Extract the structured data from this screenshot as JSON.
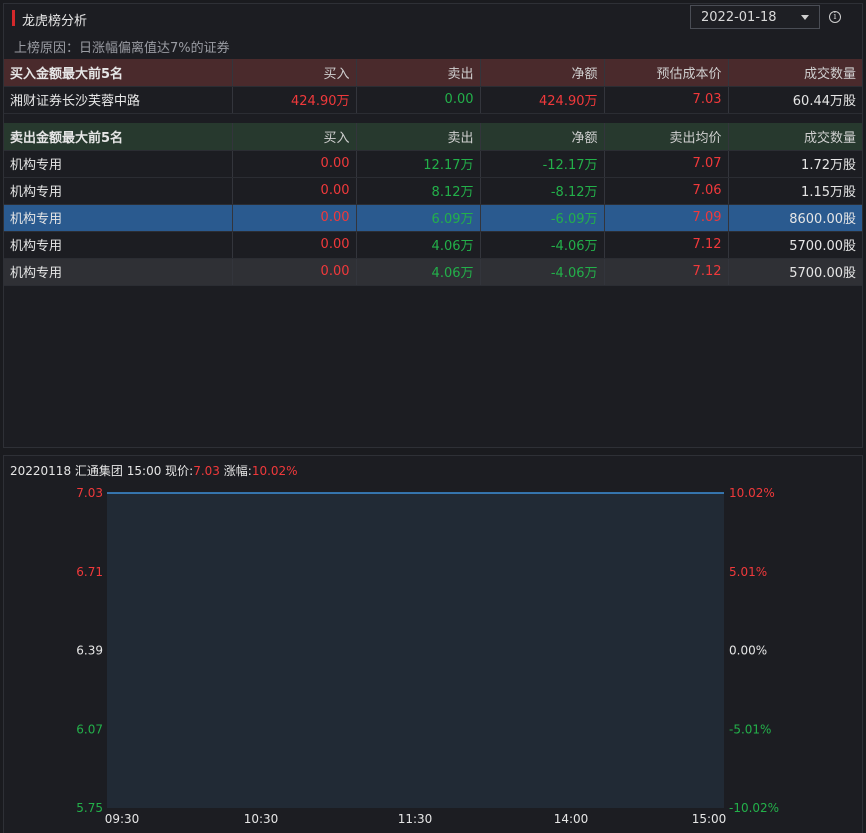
{
  "header": {
    "title": "龙虎榜分析",
    "date": "2022-01-18",
    "info_icon": "info-icon"
  },
  "reason": "上榜原因：日涨幅偏离值达7%的证券",
  "buy_table": {
    "headers": [
      "买入金额最大前5名",
      "买入",
      "卖出",
      "净额",
      "预估成本价",
      "成交数量"
    ],
    "rows": [
      [
        "湘财证券长沙芙蓉中路",
        "424.90万",
        "0.00",
        "424.90万",
        "7.03",
        "60.44万股"
      ]
    ]
  },
  "sell_table": {
    "headers": [
      "卖出金额最大前5名",
      "买入",
      "卖出",
      "净额",
      "卖出均价",
      "成交数量"
    ],
    "rows": [
      [
        "机构专用",
        "0.00",
        "12.17万",
        "-12.17万",
        "7.07",
        "1.72万股"
      ],
      [
        "机构专用",
        "0.00",
        "8.12万",
        "-8.12万",
        "7.06",
        "1.15万股"
      ],
      [
        "机构专用",
        "0.00",
        "6.09万",
        "-6.09万",
        "7.09",
        "8600.00股"
      ],
      [
        "机构专用",
        "0.00",
        "4.06万",
        "-4.06万",
        "7.12",
        "5700.00股"
      ],
      [
        "机构专用",
        "0.00",
        "4.06万",
        "-4.06万",
        "7.12",
        "5700.00股"
      ]
    ],
    "selected_row": 2,
    "hover_row": 4
  },
  "chart_info": {
    "date": "20220118",
    "stock": "汇通集团",
    "time": "15:00",
    "price_label": "现价:",
    "price": "7.03",
    "change_label": "涨幅:",
    "change": "10.02%"
  },
  "chart_data": {
    "type": "line",
    "x_ticks": [
      "09:30",
      "10:30",
      "11:30",
      "14:00",
      "15:00"
    ],
    "y_left_ticks": [
      "7.03",
      "6.71",
      "6.39",
      "6.07",
      "5.75"
    ],
    "y_right_ticks": [
      "10.02%",
      "5.01%",
      "0.00%",
      "-5.01%",
      "-10.02%"
    ],
    "ylim": [
      5.75,
      7.03
    ],
    "series": [
      {
        "values": [
          7.03,
          7.03
        ]
      }
    ],
    "colors": {
      "up": "#f0393b",
      "flat": "#e6e6e6",
      "down": "#23b04a",
      "line": "#3d8fd8",
      "plot_bg": "#212a35"
    }
  }
}
